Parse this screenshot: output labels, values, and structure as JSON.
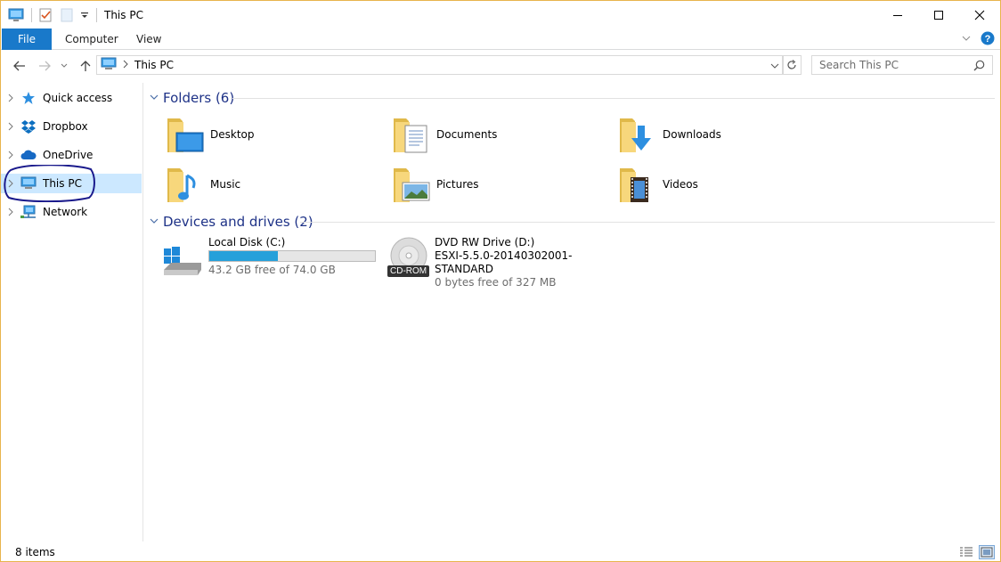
{
  "window": {
    "title": "This PC"
  },
  "ribbon": {
    "tabs": [
      "File",
      "Computer",
      "View"
    ]
  },
  "address": {
    "path": "This PC"
  },
  "search": {
    "placeholder": "Search This PC"
  },
  "nav": {
    "items": [
      {
        "label": "Quick access",
        "icon": "star-icon"
      },
      {
        "label": "Dropbox",
        "icon": "dropbox-icon"
      },
      {
        "label": "OneDrive",
        "icon": "cloud-icon"
      },
      {
        "label": "This PC",
        "icon": "computer-icon",
        "selected": true
      },
      {
        "label": "Network",
        "icon": "network-icon"
      }
    ]
  },
  "folders": {
    "header": "Folders (6)",
    "items": [
      {
        "label": "Desktop",
        "icon": "desktop-folder-icon"
      },
      {
        "label": "Documents",
        "icon": "documents-folder-icon"
      },
      {
        "label": "Downloads",
        "icon": "downloads-folder-icon"
      },
      {
        "label": "Music",
        "icon": "music-folder-icon"
      },
      {
        "label": "Pictures",
        "icon": "pictures-folder-icon"
      },
      {
        "label": "Videos",
        "icon": "videos-folder-icon"
      }
    ]
  },
  "drives": {
    "header": "Devices and drives (2)",
    "items": [
      {
        "name": "Local Disk (C:)",
        "free_text": "43.2 GB free of 74.0 GB",
        "used_fraction": 0.416,
        "icon": "hard-disk-icon"
      },
      {
        "name": "DVD RW Drive (D:)",
        "subtitle": "ESXI-5.5.0-20140302001-STANDARD",
        "free_text": "0 bytes free of 327 MB",
        "badge": "CD-ROM",
        "icon": "cd-rom-icon"
      }
    ]
  },
  "status": {
    "items": "8 items"
  },
  "colors": {
    "accent": "#1979ca",
    "selection": "#cce8ff",
    "group_header": "#1e3287",
    "bar_fill": "#26a0da"
  }
}
